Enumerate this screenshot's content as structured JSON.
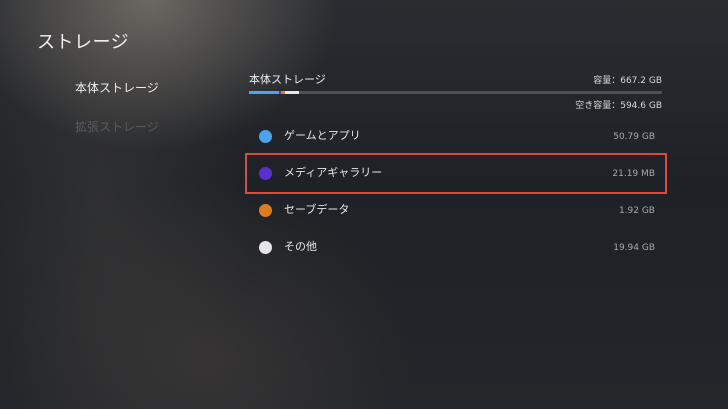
{
  "page": {
    "title": "ストレージ"
  },
  "sidebar": {
    "items": [
      {
        "label": "本体ストレージ",
        "active": true
      },
      {
        "label": "拡張ストレージ",
        "active": false
      }
    ]
  },
  "storage": {
    "label": "本体ストレージ",
    "capacity_text": "容量：667.2 GB",
    "free_text": "空き容量：594.6 GB",
    "usage_fraction": 0.109,
    "bar_colors": {
      "games": "#4aa3f0",
      "media": "#5a2fd0",
      "saves": "#e07b1f",
      "other": "#e8e8e8",
      "free": "#4d5058"
    }
  },
  "categories": [
    {
      "name": "ゲームとアプリ",
      "size": "50.79 GB",
      "color": "#4aa3f0",
      "highlighted": false
    },
    {
      "name": "メディアギャラリー",
      "size": "21.19 MB",
      "color": "#5a2fd0",
      "highlighted": true
    },
    {
      "name": "セーブデータ",
      "size": "1.92 GB",
      "color": "#e07b1f",
      "highlighted": false
    },
    {
      "name": "その他",
      "size": "19.94 GB",
      "color": "#e6e6e6",
      "highlighted": false
    }
  ],
  "highlight_color": "#de4a37"
}
